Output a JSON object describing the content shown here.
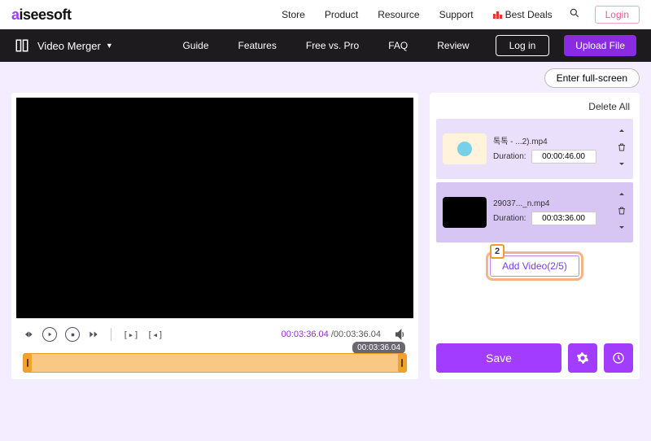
{
  "brand": {
    "name": "aiseesoft"
  },
  "topnav": {
    "links": [
      "Store",
      "Product",
      "Resource",
      "Support"
    ],
    "best_deals": "Best Deals",
    "login": "Login"
  },
  "subnav": {
    "title": "Video Merger",
    "links": [
      "Guide",
      "Features",
      "Free vs. Pro",
      "FAQ",
      "Review"
    ],
    "login": "Log in",
    "upload": "Upload File"
  },
  "stage": {
    "fullscreen": "Enter full-screen",
    "time_current": "00:03:36.04",
    "time_total": "00:03:36.04",
    "timeline_badge": "00:03:36.04"
  },
  "right": {
    "delete_all": "Delete All",
    "duration_label": "Duration:",
    "clips": [
      {
        "name": "톡톡 - ...2).mp4",
        "duration": "00:00:46.00"
      },
      {
        "name": "29037..._n.mp4",
        "duration": "00:03:36.00"
      }
    ],
    "add_video": "Add Video(2/5)",
    "badge_num": "2",
    "save": "Save"
  }
}
